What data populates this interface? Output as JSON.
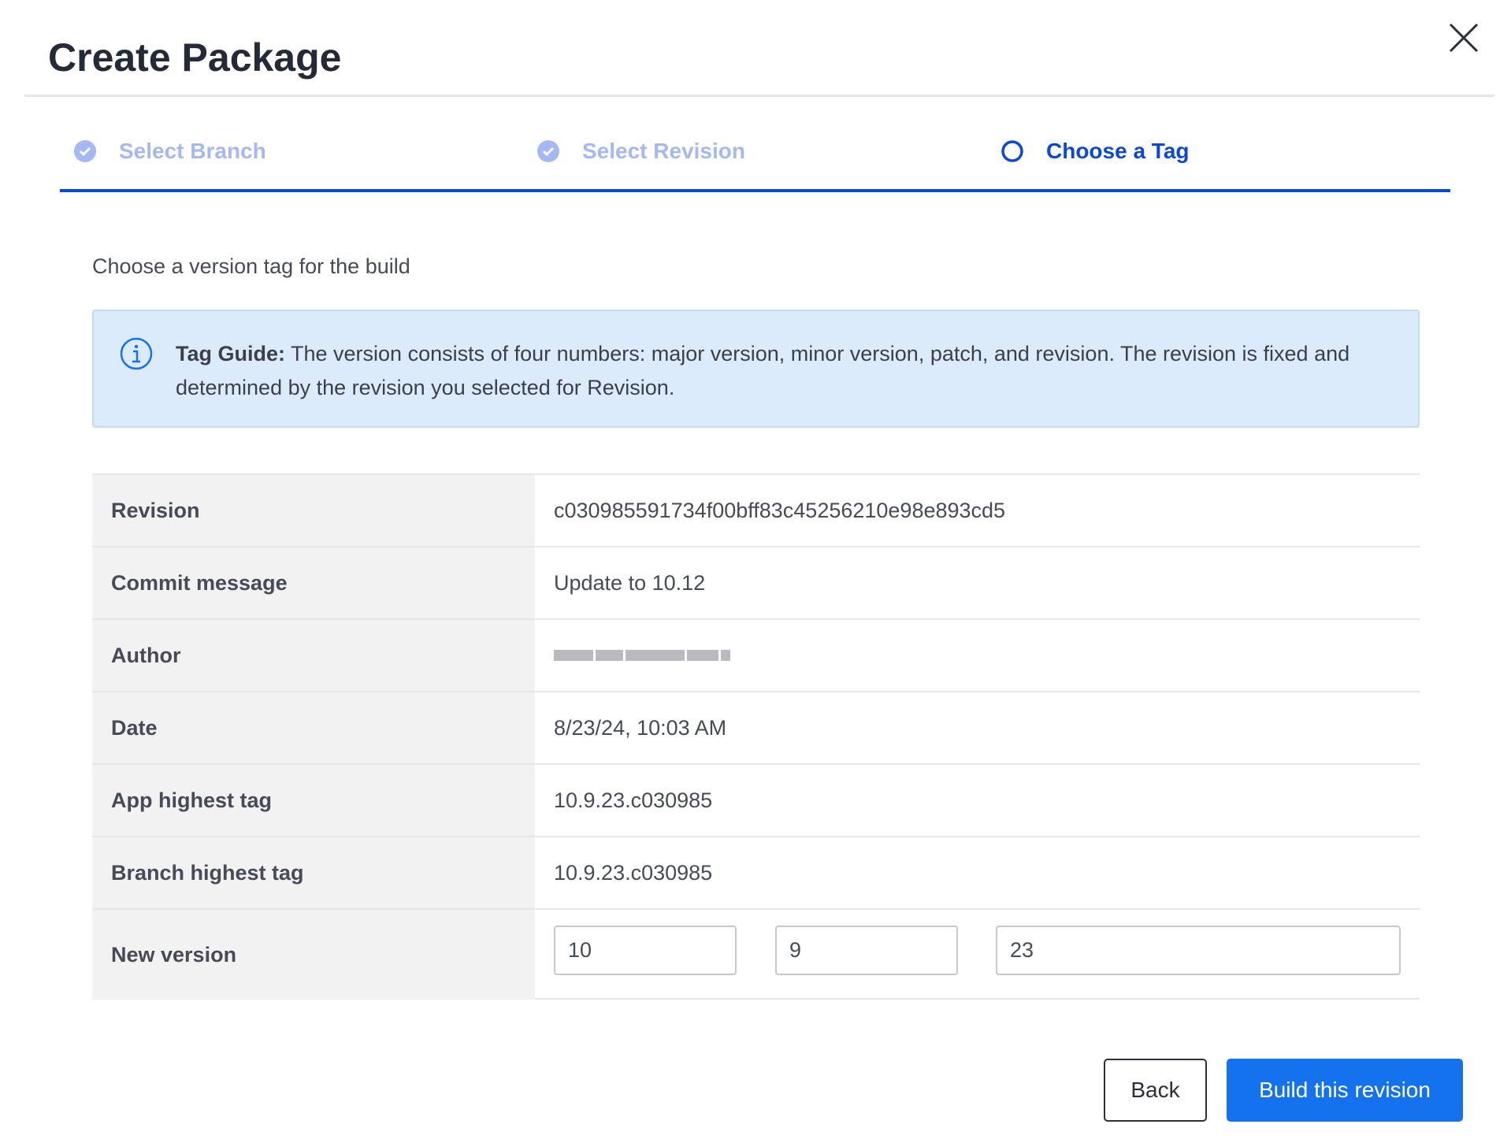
{
  "dialog": {
    "title": "Create Package",
    "close_icon": "close-icon"
  },
  "steps": [
    {
      "label": "Select Branch",
      "state": "done"
    },
    {
      "label": "Select Revision",
      "state": "done"
    },
    {
      "label": "Choose a Tag",
      "state": "active"
    }
  ],
  "intro": "Choose a version tag for the build",
  "info": {
    "title": "Tag Guide:",
    "text": " The version consists of four numbers: major version, minor version, patch, and revision. The revision is fixed and determined by the revision you selected for Revision."
  },
  "details": [
    {
      "label": "Revision",
      "value": "c030985591734f00bff83c45256210e98e893cd5"
    },
    {
      "label": "Commit message",
      "value": "Update to 10.12"
    },
    {
      "label": "Author",
      "value": null
    },
    {
      "label": "Date",
      "value": "8/23/24, 10:03 AM"
    },
    {
      "label": "App highest tag",
      "value": "10.9.23.c030985"
    },
    {
      "label": "Branch highest tag",
      "value": "10.9.23.c030985"
    }
  ],
  "new_version": {
    "label": "New version",
    "major": "10",
    "minor": "9",
    "patch": "23"
  },
  "buttons": {
    "back": "Back",
    "build": "Build this revision"
  },
  "colors": {
    "accent": "#0a48d6",
    "primary_button": "#1572ee",
    "info_bg": "#dbebfb"
  }
}
